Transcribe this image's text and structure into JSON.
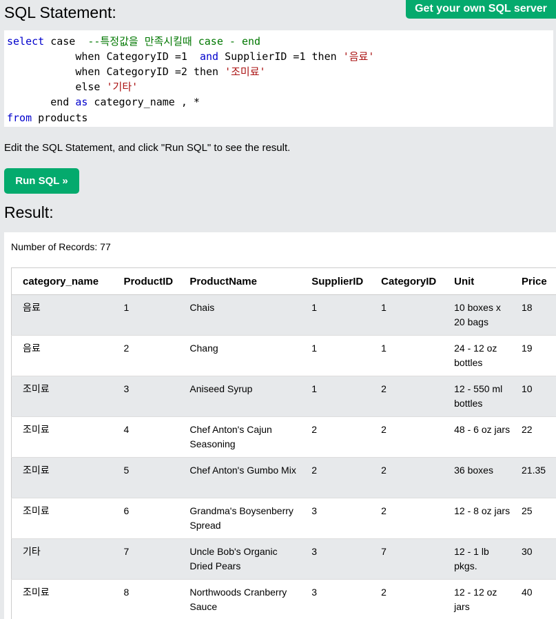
{
  "header": {
    "get_server_label": "Get your own SQL server",
    "sql_heading": "SQL Statement:"
  },
  "editor": {
    "line1": {
      "kw1": "select",
      "plain1": " case  ",
      "comment": "--특정값을 만족시킬때 case - end"
    },
    "line2": {
      "kw1": "when",
      "plain1": " CategoryID =1  ",
      "kw2": "and",
      "plain2": " SupplierID =1 ",
      "kw3": "then",
      "str1": "'음료'"
    },
    "line3": {
      "kw1": "when",
      "plain1": " CategoryID =2 ",
      "kw2": "then",
      "str1": "'조미료'"
    },
    "line4": {
      "kw1": "else",
      "str1": "'기타'"
    },
    "line5": {
      "kw1": "end",
      "kw2": "as",
      "plain1": " category_name , *"
    },
    "line6": {
      "kw1": "from",
      "plain1": " products"
    }
  },
  "instruction": "Edit the SQL Statement, and click \"Run SQL\" to see the result.",
  "run_button_label": "Run SQL »",
  "result_heading": "Result:",
  "record_count": "Number of Records: 77",
  "table": {
    "columns": [
      "category_name",
      "ProductID",
      "ProductName",
      "SupplierID",
      "CategoryID",
      "Unit",
      "Price"
    ],
    "rows": [
      [
        "음료",
        "1",
        "Chais",
        "1",
        "1",
        "10 boxes x 20 bags",
        "18"
      ],
      [
        "음료",
        "2",
        "Chang",
        "1",
        "1",
        "24 - 12 oz bottles",
        "19"
      ],
      [
        "조미료",
        "3",
        "Aniseed Syrup",
        "1",
        "2",
        "12 - 550 ml bottles",
        "10"
      ],
      [
        "조미료",
        "4",
        "Chef Anton's Cajun Seasoning",
        "2",
        "2",
        "48 - 6 oz jars",
        "22"
      ],
      [
        "조미료",
        "5",
        "Chef Anton's Gumbo Mix",
        "2",
        "2",
        "36 boxes",
        "21.35"
      ],
      [
        "조미료",
        "6",
        "Grandma's Boysenberry Spread",
        "3",
        "2",
        "12 - 8 oz jars",
        "25"
      ],
      [
        "기타",
        "7",
        "Uncle Bob's Organic Dried Pears",
        "3",
        "7",
        "12 - 1 lb pkgs.",
        "30"
      ],
      [
        "조미료",
        "8",
        "Northwoods Cranberry Sauce",
        "3",
        "2",
        "12 - 12 oz jars",
        "40"
      ]
    ]
  },
  "colors": {
    "accent_green": "#04aa6d",
    "page_bg": "#e7e9eb",
    "keyword_blue": "#0000cc",
    "comment_green": "#007700",
    "string_red": "#aa1111"
  }
}
